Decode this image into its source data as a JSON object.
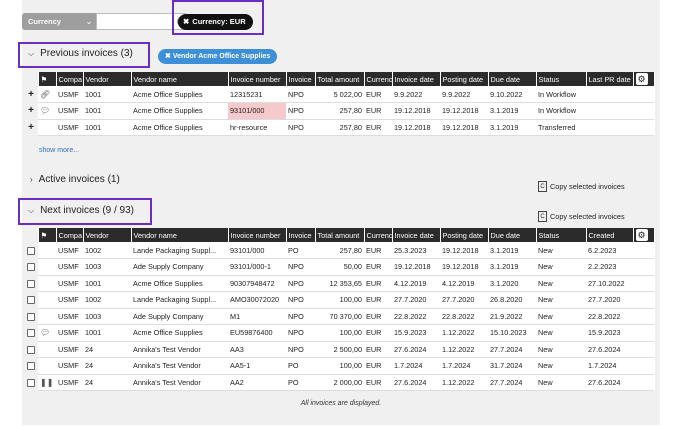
{
  "filter": {
    "currency_label": "Currency",
    "currency_chip": "Currency: EUR"
  },
  "previous": {
    "title": "Previous invoices (3)",
    "vendor_chip": "Vendor Acme Office Supplies",
    "show_more": "show more..."
  },
  "active": {
    "title": "Active invoices (1)",
    "copy_label": "Copy selected invoices"
  },
  "next": {
    "title": "Next invoices (9 / 93)",
    "copy_label": "Copy selected invoices",
    "footer": "All invoices are displayed."
  },
  "prev_columns": [
    "Compa",
    "Vendor",
    "Vendor name",
    "Invoice number",
    "Invoice",
    "Total amount",
    "Currency",
    "Invoice date",
    "Posting date",
    "Due date",
    "Status",
    "Last PR date"
  ],
  "next_columns": [
    "Compa",
    "Vendor",
    "Vendor name",
    "Invoice number",
    "Invoice",
    "Total amount",
    "Currency",
    "Invoice date",
    "Posting date",
    "Due date",
    "Status",
    "Created"
  ],
  "prev_rows": [
    {
      "lead": "+",
      "icon": "paperclip-icon",
      "cells": [
        "USMF",
        "1001",
        "Acme Office Supplies",
        "12315231",
        "NPO",
        "5 022,00",
        "EUR",
        "9.9.2022",
        "9.9.2022",
        "9.10.2022",
        "In Workflow",
        ""
      ]
    },
    {
      "lead": "+",
      "icon": "comment-icon",
      "cells": [
        "USMF",
        "1001",
        "Acme Office Supplies",
        "93101/000",
        "NPO",
        "257,80",
        "EUR",
        "19.12.2018",
        "19.12.2018",
        "3.1.2019",
        "In Workflow",
        ""
      ]
    },
    {
      "lead": "+",
      "icon": "",
      "cells": [
        "USMF",
        "1001",
        "Acme Office Supplies",
        "hr-resource",
        "NPO",
        "257,80",
        "EUR",
        "19.12.2018",
        "19.12.2018",
        "3.1.2019",
        "Transferred",
        ""
      ]
    }
  ],
  "next_rows": [
    {
      "icon": "",
      "cells": [
        "USMF",
        "1002",
        "Lande Packaging Suppl...",
        "93101/000",
        "PO",
        "257,80",
        "EUR",
        "25.3.2023",
        "19.12.2018",
        "3.1.2019",
        "New",
        "6.2.2023"
      ]
    },
    {
      "icon": "",
      "cells": [
        "USMF",
        "1003",
        "Ade Supply Company",
        "93101/000-1",
        "NPO",
        "50,00",
        "EUR",
        "19.12.2018",
        "19.12.2018",
        "3.1.2019",
        "New",
        "2.2.2023"
      ]
    },
    {
      "icon": "",
      "cells": [
        "USMF",
        "1001",
        "Acme Office Supplies",
        "90307948472",
        "NPO",
        "12 353,65",
        "EUR",
        "4.12.2019",
        "4.12.2019",
        "3.1.2020",
        "New",
        "27.10.2022"
      ]
    },
    {
      "icon": "",
      "cells": [
        "USMF",
        "1002",
        "Lande Packaging Suppl...",
        "AMO30072020",
        "NPO",
        "100,00",
        "EUR",
        "27.7.2020",
        "27.7.2020",
        "26.8.2020",
        "New",
        "27.7.2020"
      ]
    },
    {
      "icon": "",
      "cells": [
        "USMF",
        "1003",
        "Ade Supply Company",
        "M1",
        "NPO",
        "70 370,00",
        "EUR",
        "22.8.2022",
        "22.8.2022",
        "21.9.2022",
        "New",
        "22.8.2022"
      ]
    },
    {
      "icon": "comment-icon",
      "cells": [
        "USMF",
        "1001",
        "Acme Office Supplies",
        "EU59876400",
        "NPO",
        "100,00",
        "EUR",
        "15.9.2023",
        "1.12.2022",
        "15.10.2023",
        "New",
        "15.9.2023"
      ]
    },
    {
      "icon": "",
      "cells": [
        "USMF",
        "24",
        "Annika's Test Vendor",
        "AA3",
        "NPO",
        "2 500,00",
        "EUR",
        "27.6.2024",
        "1.12.2022",
        "27.7.2024",
        "New",
        "27.6.2024"
      ]
    },
    {
      "icon": "",
      "cells": [
        "USMF",
        "24",
        "Annika's Test Vendor",
        "AA5-1",
        "PO",
        "100,00",
        "EUR",
        "1.7.2024",
        "1.7.2024",
        "31.7.2024",
        "New",
        "1.7.2024"
      ]
    },
    {
      "icon": "pause-icon",
      "cells": [
        "USMF",
        "24",
        "Annika's Test Vendor",
        "AA2",
        "PO",
        "2 000,00",
        "EUR",
        "27.6.2024",
        "1.12.2022",
        "27.7.2024",
        "New",
        "27.6.2024"
      ]
    }
  ]
}
